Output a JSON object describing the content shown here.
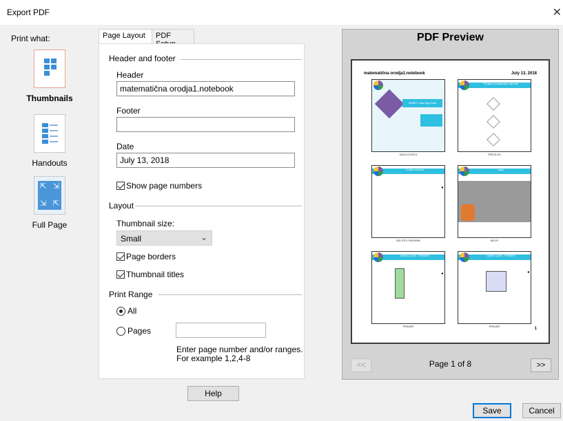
{
  "window": {
    "title": "Export PDF",
    "close_glyph": "✕"
  },
  "print_what": {
    "label": "Print what:",
    "options": [
      {
        "label": "Thumbnails",
        "icon": "thumbnails-layout-icon",
        "selected": true
      },
      {
        "label": "Handouts",
        "icon": "handouts-layout-icon",
        "selected": false
      },
      {
        "label": "Full Page",
        "icon": "full-page-layout-icon",
        "selected": false
      }
    ]
  },
  "tabs": [
    {
      "label": "Page Layout",
      "active": true
    },
    {
      "label": "PDF Setup",
      "active": false
    }
  ],
  "page_layout": {
    "header_footer_group": "Header and footer",
    "header_label": "Header",
    "header_value": "matematična orodja1.notebook",
    "footer_label": "Footer",
    "footer_value": "",
    "date_label": "Date",
    "date_value": "July 13, 2018",
    "show_page_numbers": {
      "label": "Show page numbers",
      "checked": true
    },
    "layout_group": "Layout",
    "thumbnail_size_label": "Thumbnail size:",
    "thumbnail_size_value": "Small",
    "page_borders": {
      "label": "Page borders",
      "checked": true
    },
    "thumbnail_titles": {
      "label": "Thumbnail titles",
      "checked": true
    },
    "print_range_group": "Print Range",
    "range_all": {
      "label": "All",
      "selected": true
    },
    "range_pages": {
      "label": "Pages",
      "selected": false,
      "value": ""
    },
    "hint_line1": "Enter page number and/or ranges.",
    "hint_line2": "For example 1,2,4-8"
  },
  "buttons": {
    "help": "Help",
    "save": "Save",
    "cancel": "Cancel"
  },
  "preview": {
    "title": "PDF Preview",
    "sheet_header_left": "matematična orodja1.notebook",
    "sheet_header_right": "July 13, 2018",
    "sheet_page_number": "1",
    "thumbnails": [
      {
        "title": "SMART Learning Suite",
        "caption": "NASLOVNICA"
      },
      {
        "title": "Pregled programske opreme",
        "caption": "PREGLED"
      },
      {
        "title": "Delitev ravnine",
        "caption": "DELITEV RAVNINE"
      },
      {
        "title": "Mojo",
        "caption": "MOJO"
      },
      {
        "title": "Delitev vzdih - PRIMER",
        "caption": "PRIMER"
      },
      {
        "title": "Delitev vzdih - PRIMER",
        "caption": "PRIMER"
      }
    ],
    "prev_label": "<<",
    "next_label": ">>",
    "page_label": "Page 1 of 8"
  }
}
